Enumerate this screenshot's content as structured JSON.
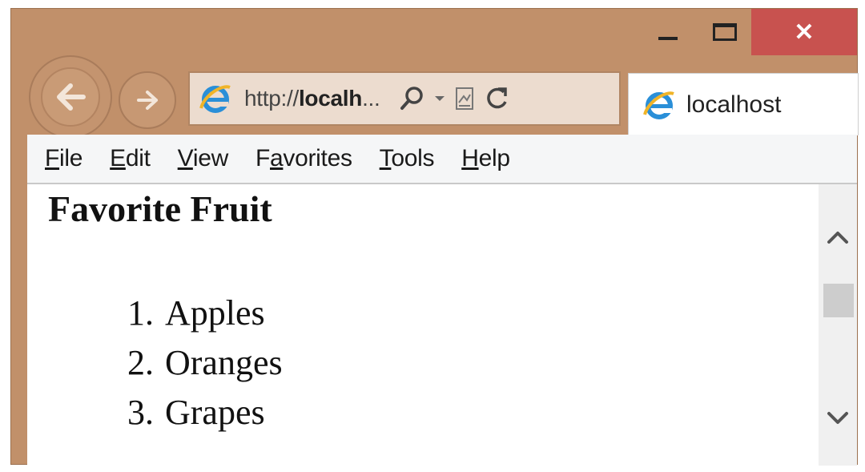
{
  "window": {
    "close_glyph": "✕",
    "accent_close": "#c8524f",
    "frame_color": "#c1906a"
  },
  "navigation": {
    "address": {
      "url_prefix": "http://",
      "url_bold": "localh",
      "url_suffix": "..."
    },
    "tab": {
      "label": "localhost"
    }
  },
  "menubar": {
    "items": [
      {
        "underline": "F",
        "rest": "ile"
      },
      {
        "underline": "E",
        "rest": "dit"
      },
      {
        "underline": "V",
        "rest": "iew"
      },
      {
        "pre": "F",
        "underline": "a",
        "rest": "vorites"
      },
      {
        "underline": "T",
        "rest": "ools"
      },
      {
        "underline": "H",
        "rest": "elp"
      }
    ]
  },
  "page": {
    "heading": "Favorite Fruit",
    "list": [
      {
        "num": "1.",
        "text": "Apples"
      },
      {
        "num": "2.",
        "text": "Oranges"
      },
      {
        "num": "3.",
        "text": "Grapes"
      }
    ]
  },
  "icons": {
    "back": "back-arrow-icon",
    "forward": "forward-arrow-icon",
    "search": "search-icon",
    "dropdown": "dropdown-arrow-icon",
    "compat": "compatibility-view-icon",
    "refresh": "refresh-icon",
    "browser": "internet-explorer-icon"
  }
}
